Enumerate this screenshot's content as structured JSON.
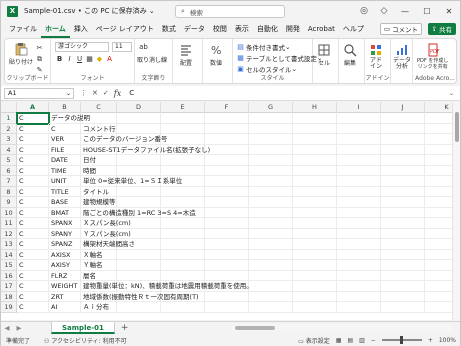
{
  "window": {
    "title": "Sample-01.csv • この PC に保存済み",
    "title_chevron": "⌄",
    "app_icon_letter": "X",
    "search_placeholder": "検索"
  },
  "tabs": [
    "ファイル",
    "ホーム",
    "挿入",
    "ページ レイアウト",
    "数式",
    "データ",
    "校閲",
    "表示",
    "自動化",
    "開発",
    "Acrobat",
    "ヘルプ"
  ],
  "active_tab": "ホーム",
  "comment_button": "コメント",
  "share_button": "共有",
  "ribbon": {
    "clipboard": {
      "paste": "貼り付け",
      "label": "クリップボード"
    },
    "font": {
      "name": "游ゴシック",
      "size": "11",
      "bold": "B",
      "italic": "I",
      "underline": "U",
      "grow": "A",
      "shrink": "A",
      "label": "フォント"
    },
    "wrap": {
      "name": "取り消し線",
      "label": "文字飾り"
    },
    "align": {
      "name": "配置"
    },
    "number": {
      "name": "数値"
    },
    "styles": {
      "cond_format": "条件付き書式",
      "table_format": "テーブルとして書式設定",
      "cell_style": "セルのスタイル",
      "label": "スタイル"
    },
    "cells": {
      "name": "セル"
    },
    "editing": {
      "name": "編集"
    },
    "addins": {
      "name": "アド\nイン",
      "label": "アドイン"
    },
    "analysis": {
      "name": "データ\n分析"
    },
    "pdf": {
      "name": "PDF を作成し\nリンクを共有",
      "label": "Adobe Acro..."
    }
  },
  "formula_bar": {
    "cell_ref": "A1",
    "fx": "fx",
    "value": "C"
  },
  "columns": [
    "A",
    "B",
    "C",
    "D",
    "E",
    "F",
    "G",
    "H",
    "I",
    "J",
    "K"
  ],
  "rows": [
    {
      "n": "1",
      "a": "C",
      "b": "データの説明",
      "c": ""
    },
    {
      "n": "2",
      "a": "C",
      "b": "C",
      "c": "コメント行"
    },
    {
      "n": "3",
      "a": "C",
      "b": "VER",
      "c": "このデータのバージョン番号"
    },
    {
      "n": "4",
      "a": "C",
      "b": "FILE",
      "c": "HOUSE-ST1データファイル名(拡張子なし)"
    },
    {
      "n": "5",
      "a": "C",
      "b": "DATE",
      "c": "日付"
    },
    {
      "n": "6",
      "a": "C",
      "b": "TIME",
      "c": "時間"
    },
    {
      "n": "7",
      "a": "C",
      "b": "UNIT",
      "c": "単位 0=従来単位、1=ＳＩ系単位"
    },
    {
      "n": "8",
      "a": "C",
      "b": "TITLE",
      "c": "タイトル"
    },
    {
      "n": "9",
      "a": "C",
      "b": "BASE",
      "c": "建物規模等"
    },
    {
      "n": "10",
      "a": "C",
      "b": "BMAT",
      "c": "階ごとの構造種別 1=RC 3=S 4=木造"
    },
    {
      "n": "11",
      "a": "C",
      "b": "SPANX",
      "c": "Ｘスパン長(cm)"
    },
    {
      "n": "12",
      "a": "C",
      "b": "SPANY",
      "c": "Ｙスパン長(cm)"
    },
    {
      "n": "13",
      "a": "C",
      "b": "SPANZ",
      "c": "構架材天端間高さ"
    },
    {
      "n": "14",
      "a": "C",
      "b": "AXISX",
      "c": "Ｘ軸名"
    },
    {
      "n": "15",
      "a": "C",
      "b": "AXISY",
      "c": "Ｙ軸名"
    },
    {
      "n": "16",
      "a": "C",
      "b": "FLRZ",
      "c": "層名"
    },
    {
      "n": "17",
      "a": "C",
      "b": "WEIGHT",
      "c": "建物重量(単位：kN)、積載荷重は地震用積載荷重を使用。"
    },
    {
      "n": "18",
      "a": "C",
      "b": "ZRT",
      "c": "地域係数(振動特性Ｒｔ一次固有周期(T)"
    },
    {
      "n": "19",
      "a": "C",
      "b": "AI",
      "c": "Ａｉ分布"
    }
  ],
  "sheet_tab": "Sample-01",
  "add_sheet": "+",
  "status": {
    "ready": "準備完了",
    "accessibility": "アクセシビリティ: 利用不可",
    "display_settings": "表示設定",
    "zoom": "100%"
  }
}
